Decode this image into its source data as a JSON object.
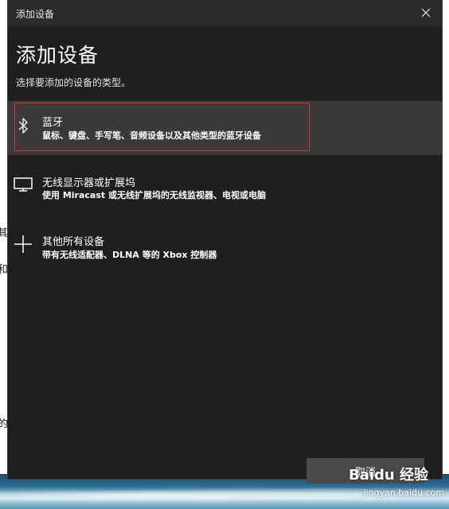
{
  "background": {
    "left_glyphs": [
      "其",
      "和",
      "的"
    ]
  },
  "dialog": {
    "window_title": "添加设备",
    "heading": "添加设备",
    "subheading": "选择要添加的设备的类型。",
    "options": [
      {
        "icon": "bluetooth-icon",
        "title": "蓝牙",
        "description": "鼠标、键盘、手写笔、音频设备以及其他类型的蓝牙设备",
        "selected": true
      },
      {
        "icon": "monitor-icon",
        "title": "无线显示器或扩展坞",
        "description": "使用 Miracast 或无线扩展坞的无线监视器、电视或电脑",
        "selected": false
      },
      {
        "icon": "plus-icon",
        "title": "其他所有设备",
        "description": "带有无线适配器、DLNA 等的 Xbox 控制器",
        "selected": false
      }
    ],
    "cancel_label": "取消"
  },
  "watermark": {
    "brand": "Baidu 经验",
    "url": "jingyan.baidu.com"
  },
  "colors": {
    "dialog_bg": "#1f1f1f",
    "selected_bg": "#3a3a3a",
    "focus_border": "#d9322b",
    "button_bg": "#4a4a4a"
  }
}
